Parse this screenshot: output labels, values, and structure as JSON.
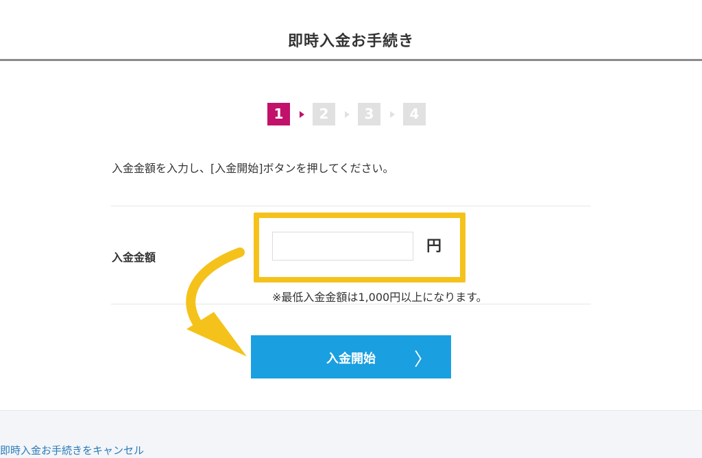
{
  "header": {
    "title": "即時入金お手続き"
  },
  "steps": [
    {
      "label": "1",
      "active": true
    },
    {
      "label": "2",
      "active": false
    },
    {
      "label": "3",
      "active": false
    },
    {
      "label": "4",
      "active": false
    }
  ],
  "instruction": "入金金額を入力し、[入金開始]ボタンを押してください。",
  "form": {
    "amount_label": "入金金額",
    "amount_value": "",
    "currency_unit": "円",
    "minimum_note": "※最低入金金額は1,000円以上になります。"
  },
  "start_button": {
    "label": "入金開始",
    "chevron": "〉"
  },
  "cancel_link": "即時入金お手続きをキャンセル",
  "colors": {
    "active_step": "#c2116a",
    "inactive_step": "#e1e1e1",
    "button": "#1a9fe0",
    "highlight": "#f5c21b",
    "link": "#2b7bb9"
  }
}
